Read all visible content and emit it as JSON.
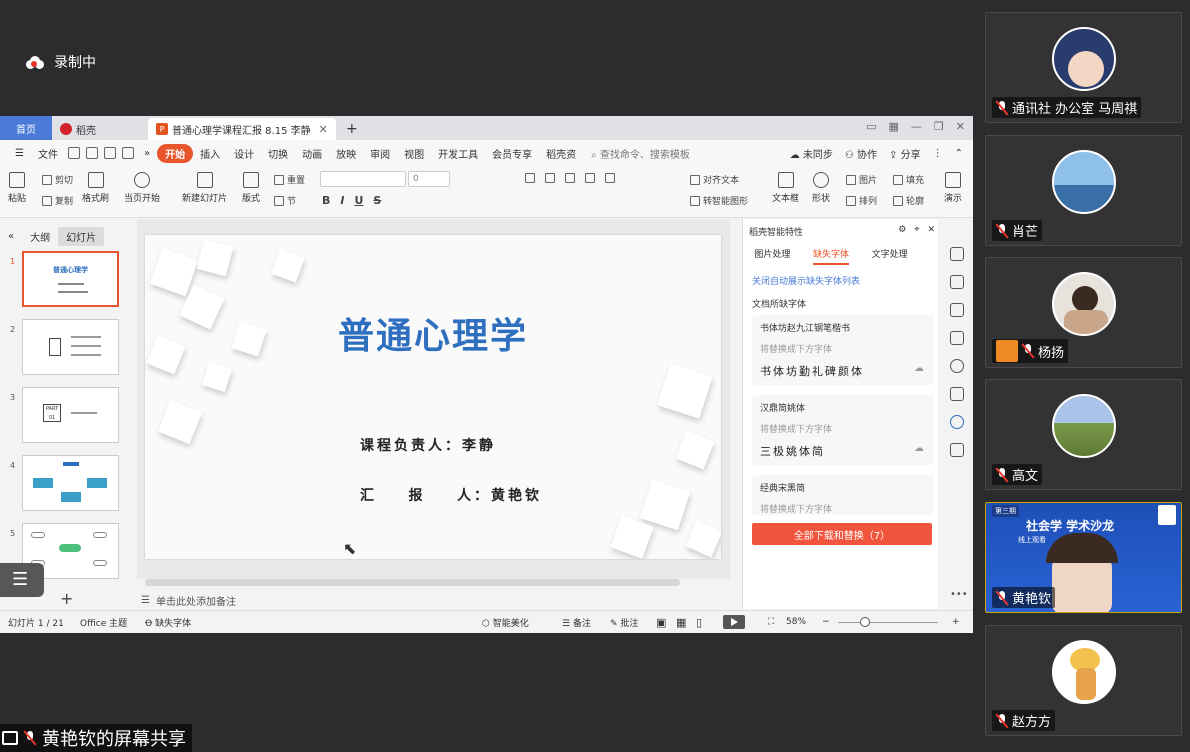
{
  "recording": {
    "label": "录制中"
  },
  "window": {
    "tabs": [
      {
        "label": "首页"
      },
      {
        "label": "稻壳"
      },
      {
        "label": "普通心理学课程汇报 8.15 李静"
      }
    ],
    "menu": [
      "文件",
      "开始",
      "插入",
      "设计",
      "切换",
      "动画",
      "放映",
      "审阅",
      "视图",
      "开发工具",
      "会员专享",
      "稻壳资"
    ],
    "search_placeholder": "查找命令、搜索模板",
    "menu_right": [
      "未同步",
      "协作",
      "分享"
    ],
    "ribbon": {
      "paste": "粘贴",
      "cut": "剪切",
      "copy": "复制",
      "format_painter": "格式刷",
      "play_current": "当页开始",
      "new_slide": "新建幻灯片",
      "layout": "版式",
      "section": "节",
      "reset": "重置",
      "font_size": "0",
      "align_text": "对齐文本",
      "smartart": "转智能图形",
      "textbox": "文本框",
      "shape": "形状",
      "picture": "图片",
      "arrange": "排列",
      "fill": "填充",
      "outline": "轮廓",
      "more": "演示"
    }
  },
  "left_panel": {
    "tabs": [
      "大纲",
      "幻灯片"
    ],
    "thumbnails": [
      {
        "num": "1",
        "title": "普通心理学"
      },
      {
        "num": "2"
      },
      {
        "num": "3",
        "title": "PART 01"
      },
      {
        "num": "4"
      },
      {
        "num": "5"
      }
    ]
  },
  "slide": {
    "title": "普通心理学",
    "line1": "课程负责人：李静",
    "line2": "汇    报    人：黄艳钦"
  },
  "notes_placeholder": "单击此处添加备注",
  "right_pane": {
    "header": "稻壳智能特性",
    "tabs": [
      "图片处理",
      "缺失字体",
      "文字处理"
    ],
    "link": "关闭自动展示缺失字体列表",
    "section": "文档所缺字体",
    "fonts": [
      {
        "name": "书体坊赵九江钢笔楷书",
        "replace_label": "将替换成下方字体",
        "replacement": "书体坊勤礼碑颜体"
      },
      {
        "name": "汉鼎简姚体",
        "replace_label": "将替换成下方字体",
        "replacement": "三极姚体简"
      },
      {
        "name": "经典宋黑简",
        "replace_label": "将替换成下方字体"
      }
    ],
    "button": "全部下载和替换（7）"
  },
  "status_bar": {
    "slide_count": "幻灯片 1 / 21",
    "theme": "Office 主题",
    "missing_font": "缺失字体",
    "smart_beautify": "智能美化",
    "notes": "备注",
    "comments": "批注",
    "zoom": "58%"
  },
  "participants": [
    {
      "name": "通讯社 办公室 马周祺",
      "avatar": "anime-avatar",
      "color": "#2a3b6e"
    },
    {
      "name": "肖芒",
      "avatar": "sea-avatar",
      "color": "#6aa0d8"
    },
    {
      "name": "杨扬",
      "avatar": "person-avatar",
      "color": "#c9a58a"
    },
    {
      "name": "高文",
      "avatar": "landscape-avatar",
      "color": "#7a9a4a"
    },
    {
      "name": "黄艳钦",
      "video_title": "社会学 学术沙龙",
      "video_sub": "线上观看",
      "video_badge": "第三期"
    },
    {
      "name": "赵方方",
      "avatar": "cartoon-avatar",
      "color": "#f2c14e"
    }
  ],
  "share_bar": {
    "label": "黄艳钦的屏幕共享"
  }
}
